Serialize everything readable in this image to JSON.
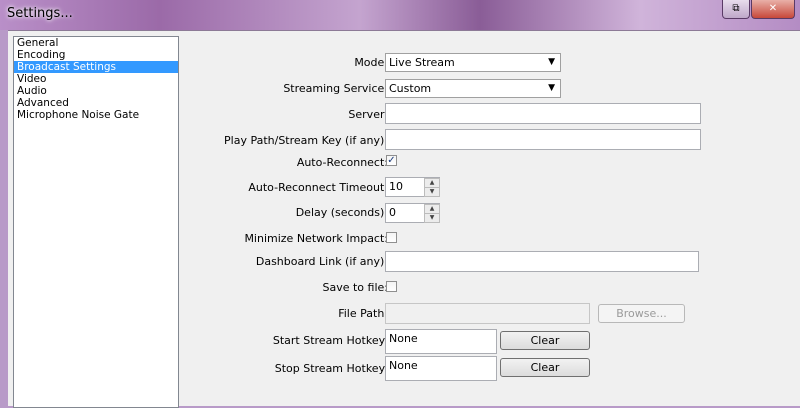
{
  "window": {
    "title": "Settings...",
    "buttons": {
      "restore": "⧉",
      "close": "✕"
    }
  },
  "sidebar": {
    "items": [
      {
        "label": "General",
        "selected": false
      },
      {
        "label": "Encoding",
        "selected": false
      },
      {
        "label": "Broadcast Settings",
        "selected": true
      },
      {
        "label": "Video",
        "selected": false
      },
      {
        "label": "Audio",
        "selected": false
      },
      {
        "label": "Advanced",
        "selected": false
      },
      {
        "label": "Microphone Noise Gate",
        "selected": false
      }
    ]
  },
  "form": {
    "mode": {
      "label": "Mode:",
      "value": "Live Stream"
    },
    "service": {
      "label": "Streaming Service:",
      "value": "Custom"
    },
    "server": {
      "label": "Server:",
      "value": ""
    },
    "stream_key": {
      "label": "Play Path/Stream Key (if any):",
      "value": ""
    },
    "auto_reconnect": {
      "label": "Auto-Reconnect:",
      "checked": true
    },
    "reconnect_timeout": {
      "label": "Auto-Reconnect Timeout:",
      "value": "10"
    },
    "delay": {
      "label": "Delay (seconds):",
      "value": "0"
    },
    "minimize_network": {
      "label": "Minimize Network Impact:",
      "checked": false
    },
    "dashboard": {
      "label": "Dashboard Link (if any):",
      "value": ""
    },
    "save_to_file": {
      "label": "Save to file:",
      "checked": false
    },
    "file_path": {
      "label": "File Path:",
      "value": "",
      "browse_label": "Browse..."
    },
    "start_hotkey": {
      "label": "Start Stream Hotkey:",
      "value": "None",
      "clear_label": "Clear"
    },
    "stop_hotkey": {
      "label": "Stop Stream Hotkey:",
      "value": "None",
      "clear_label": "Clear"
    }
  },
  "glyphs": {
    "checkmark": "✓",
    "dropdown_arrow": "▼",
    "spin_up": "▲",
    "spin_down": "▼"
  }
}
